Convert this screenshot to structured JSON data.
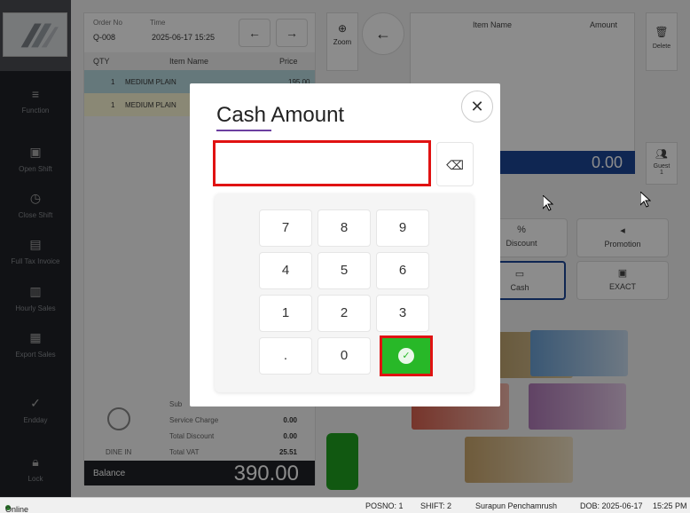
{
  "sidebar": {
    "items": [
      {
        "label": "Function",
        "icon": "menu-icon"
      },
      {
        "label": "Open Shift",
        "icon": "register-icon"
      },
      {
        "label": "Close Shift",
        "icon": "clock-icon"
      },
      {
        "label": "Full Tax Invoice",
        "icon": "invoice-icon"
      },
      {
        "label": "Hourly Sales",
        "icon": "document-icon"
      },
      {
        "label": "Export Sales",
        "icon": "txt-icon"
      },
      {
        "label": "Endday",
        "icon": "shield-check-icon"
      },
      {
        "label": "Lock",
        "icon": "lock-icon"
      }
    ]
  },
  "order": {
    "order_no_label": "Order No",
    "order_no": "Q-008",
    "time_label": "Time",
    "time": "2025-06-17 15:25",
    "col_qty": "QTY",
    "col_item": "Item Name",
    "col_price": "Price",
    "lines": [
      {
        "qty": "1",
        "name": "MEDIUM PLAIN",
        "price": "195.00"
      },
      {
        "qty": "1",
        "name": "MEDIUM PLAIN",
        "price": ""
      }
    ],
    "sub_label": "Sub",
    "service_label": "Service Charge",
    "service_value": "0.00",
    "discount_label": "Total Discount",
    "discount_value": "0.00",
    "vat_label": "Total VAT",
    "vat_value": "25.51",
    "dine_label": "DINE IN",
    "balance_label": "Balance",
    "balance_value": "390.00"
  },
  "right": {
    "zoom_label": "Zoom",
    "item_name_header": "Item Name",
    "amount_header": "Amount",
    "delete_label": "Delete",
    "guest_label": "Guest",
    "guest_count": "1",
    "amount_display": "0.00",
    "discount_label": "Discount",
    "promotion_label": "Promotion",
    "cash_label": "Cash",
    "exact_label": "EXACT"
  },
  "modal": {
    "title": "Cash Amount",
    "input_value": "",
    "keys": [
      "7",
      "8",
      "9",
      "4",
      "5",
      "6",
      "1",
      "2",
      "3",
      ".",
      "0"
    ]
  },
  "statusbar": {
    "online": "Online",
    "posno": "POSNO: 1",
    "shift": "SHIFT: 2",
    "user": "Surapun Penchamrush",
    "dob": "DOB: 2025-06-17",
    "time": "15:25 PM"
  },
  "colors": {
    "confirm_green": "#28b828",
    "highlight_red": "#e01212",
    "accent_blue": "#1d4696"
  }
}
